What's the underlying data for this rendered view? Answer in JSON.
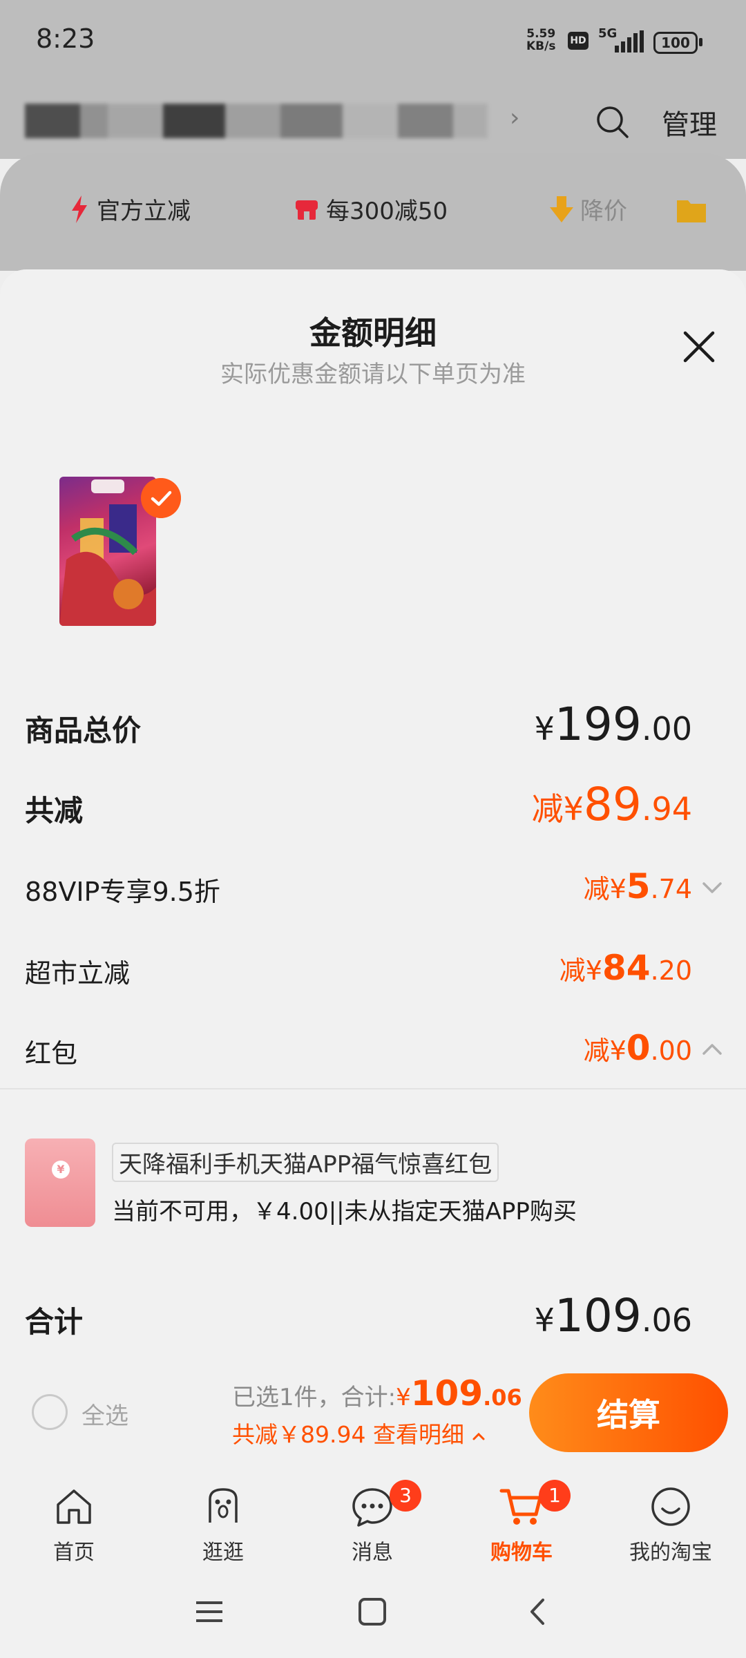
{
  "status_bar": {
    "time": "8:23",
    "speed": "5.59",
    "speed_unit": "KB/s",
    "hd": "HD",
    "network": "5G",
    "battery": "100"
  },
  "header": {
    "manage_label": "管理",
    "chevron": "›"
  },
  "promo_tags": [
    {
      "label": "官方立减",
      "icon": "lightning-icon"
    },
    {
      "label": "每300减50",
      "icon": "store-icon"
    },
    {
      "label": "降价",
      "icon": "arrow-down-icon"
    },
    {
      "label": "",
      "icon": "folder-icon"
    }
  ],
  "sheet": {
    "title": "金额明细",
    "subtitle": "实际优惠金额请以下单页为准",
    "rows": [
      {
        "label": "商品总价",
        "prefix": "¥",
        "int": "199",
        "dec": ".00"
      },
      {
        "label": "共减",
        "prefix": "减¥",
        "int": "89",
        "dec": ".94"
      },
      {
        "label": "88VIP专享9.5折",
        "prefix": "减¥",
        "int": "5",
        "dec": ".74"
      },
      {
        "label": "超市立减",
        "prefix": "减¥",
        "int": "84",
        "dec": ".20"
      },
      {
        "label": "红包",
        "prefix": "减¥",
        "int": "0",
        "dec": ".00"
      },
      {
        "label": "合计",
        "prefix": "¥",
        "int": "109",
        "dec": ".06"
      }
    ],
    "redpack": {
      "title": "天降福利手机天猫APP福气惊喜红包",
      "desc": "当前不可用，￥4.00||未从指定天猫APP购买",
      "coin": "¥"
    }
  },
  "bottom_bar": {
    "select_all": "全选",
    "selected_text": "已选1件，合计:",
    "total_prefix": "¥",
    "total_int": "109",
    "total_dec": ".06",
    "discount_text": "共减￥89.94  查看明细",
    "checkout": "结算"
  },
  "tabs": [
    {
      "label": "首页",
      "icon": "home-icon",
      "badge": ""
    },
    {
      "label": "逛逛",
      "icon": "browse-icon",
      "badge": ""
    },
    {
      "label": "消息",
      "icon": "message-icon",
      "badge": "3"
    },
    {
      "label": "购物车",
      "icon": "cart-icon",
      "badge": "1"
    },
    {
      "label": "我的淘宝",
      "icon": "profile-icon",
      "badge": ""
    }
  ],
  "colors": {
    "accent": "#ff5000",
    "badge": "#ff3d1a"
  }
}
